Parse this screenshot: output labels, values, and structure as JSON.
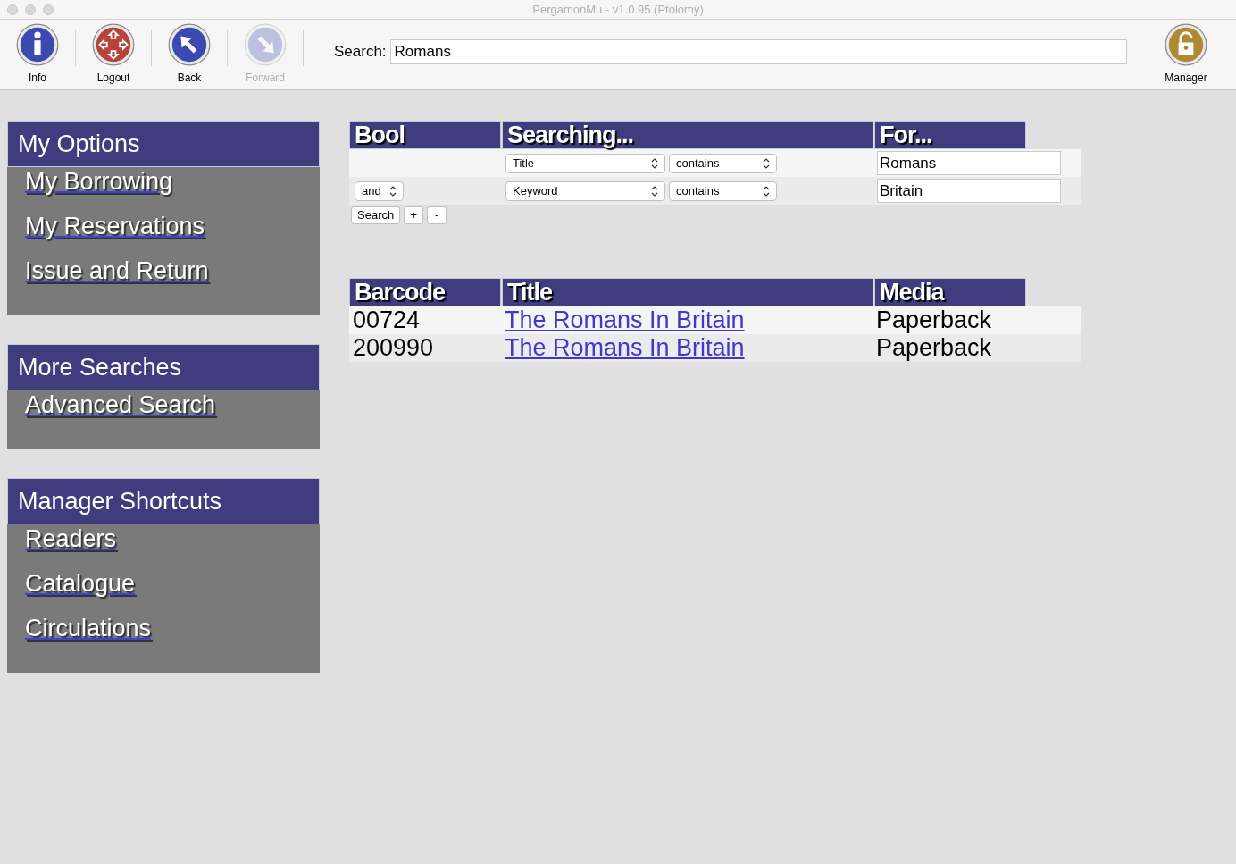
{
  "window": {
    "title": "PergamonMu - v1.0.95 (Ptolomy)"
  },
  "toolbar": {
    "buttons": [
      {
        "kind": "info",
        "label": "Info",
        "disabled": false
      },
      {
        "kind": "logout",
        "label": "Logout",
        "disabled": false
      },
      {
        "kind": "back",
        "label": "Back",
        "disabled": false
      },
      {
        "kind": "forward",
        "label": "Forward",
        "disabled": true
      }
    ],
    "search": {
      "label": "Search:",
      "value": "Romans"
    },
    "manager": {
      "kind": "manager",
      "label": "Manager",
      "disabled": false
    }
  },
  "sidebar": [
    {
      "title": "My Options",
      "items": [
        "My Borrowing",
        "My Reservations",
        "Issue and Return"
      ]
    },
    {
      "title": "More Searches",
      "items": [
        "Advanced Search"
      ]
    },
    {
      "title": "Manager Shortcuts",
      "items": [
        "Readers",
        "Catalogue",
        "Circulations"
      ]
    }
  ],
  "search_form": {
    "columns": [
      "Bool",
      "Searching...",
      "For..."
    ],
    "rows": [
      {
        "bool": null,
        "field": "Title",
        "operator": "contains",
        "value": "Romans"
      },
      {
        "bool": "and",
        "field": "Keyword",
        "operator": "contains",
        "value": "Britain"
      }
    ],
    "buttons": [
      "Search",
      "+",
      "-"
    ]
  },
  "results": {
    "columns": [
      "Barcode",
      "Title",
      "Media"
    ],
    "rows": [
      {
        "barcode": "00724",
        "title": "The Romans In Britain",
        "media": "Paperback"
      },
      {
        "barcode": "200990",
        "title": "The Romans In Britain",
        "media": "Paperback"
      }
    ]
  }
}
